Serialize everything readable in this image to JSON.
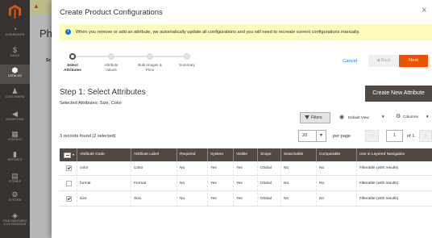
{
  "sidebar": {
    "items": [
      {
        "label": "DASHBOARD",
        "icon": "speedometer-icon",
        "glyph": "◔"
      },
      {
        "label": "SALES",
        "icon": "dollar-icon",
        "glyph": "$"
      },
      {
        "label": "CATALOG",
        "icon": "cube-icon",
        "glyph": "⬢"
      },
      {
        "label": "CUSTOMERS",
        "icon": "person-icon",
        "glyph": "♟"
      },
      {
        "label": "MARKETING",
        "icon": "megaphone-icon",
        "glyph": "◀"
      },
      {
        "label": "CONTENT",
        "icon": "layout-icon",
        "glyph": "▦"
      },
      {
        "label": "REPORTS",
        "icon": "bar-chart-icon",
        "glyph": "▮"
      },
      {
        "label": "STORES",
        "icon": "store-icon",
        "glyph": "▤"
      },
      {
        "label": "SYSTEM",
        "icon": "gear-icon",
        "glyph": "⚙"
      },
      {
        "label": "FIND PARTNERS & EXTENSIONS",
        "icon": "box-icon",
        "glyph": "◈"
      }
    ]
  },
  "background": {
    "title_fragment": "Ph",
    "sc_fragment": "Sc"
  },
  "modal": {
    "title": "Create Product Configurations",
    "close_glyph": "×",
    "notice": "When you remove or add an attribute, we automatically update all configurations and you will need to recreate current configurations manually."
  },
  "wizard": {
    "steps": [
      {
        "label_line1": "Select",
        "label_line2": "Attributes"
      },
      {
        "label_line1": "Attribute",
        "label_line2": "Values"
      },
      {
        "label_line1": "Bulk Images &",
        "label_line2": "Price"
      },
      {
        "label_line1": "Summary",
        "label_line2": ""
      }
    ],
    "cancel": "Cancel",
    "back": "Back",
    "next": "Next"
  },
  "step": {
    "title": "Step 1: Select Attributes",
    "selected": "Selected Attributes: Size, Color",
    "create_button": "Create New Attribute"
  },
  "toolbar": {
    "filters": "Filters",
    "view": "Default View",
    "columns": "Columns",
    "records": "3 records found (2 selected)",
    "per_page_value": "20",
    "per_page_label": "per page",
    "page": "1",
    "of_pages": "of 1"
  },
  "grid": {
    "columns": [
      "Attribute Code",
      "Attribute Label",
      "Required",
      "System",
      "Visible",
      "Scope",
      "Searchable",
      "Comparable",
      "Use in Layered Navigation"
    ],
    "rows": [
      {
        "checked": true,
        "cells": [
          "color",
          "Color",
          "No",
          "Yes",
          "Yes",
          "Global",
          "No",
          "No",
          "Filterable (with results)"
        ]
      },
      {
        "checked": false,
        "cells": [
          "format",
          "Format",
          "No",
          "Yes",
          "Yes",
          "Global",
          "No",
          "No",
          "Filterable (with results)"
        ]
      },
      {
        "checked": true,
        "cells": [
          "size",
          "Size",
          "No",
          "Yes",
          "Yes",
          "Global",
          "No",
          "No",
          "Filterable (with results)"
        ]
      }
    ]
  },
  "colors": {
    "accent": "#eb5202",
    "header": "#514943",
    "notice": "#fffbbb",
    "link": "#007bdb",
    "sidebar": "#373330"
  }
}
